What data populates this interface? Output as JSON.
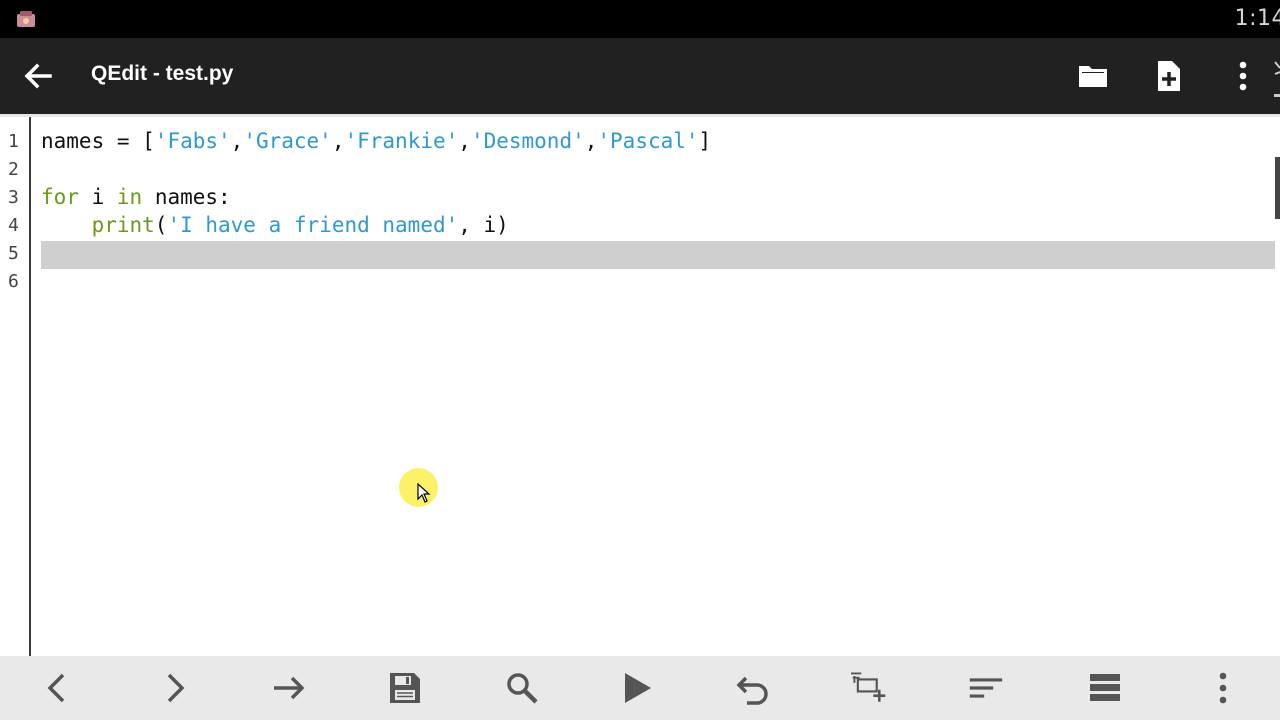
{
  "status": {
    "time": "1:14"
  },
  "header": {
    "title": "QEdit - test.py"
  },
  "editor": {
    "line_numbers": [
      "1",
      "2",
      "3",
      "4",
      "5",
      "6"
    ],
    "lines": {
      "l1": {
        "a": "names = [",
        "s1": "'Fabs'",
        "c1": ",",
        "s2": "'Grace'",
        "c2": ",",
        "s3": "'Frankie'",
        "c3": ",",
        "s4": "'Desmond'",
        "c4": ",",
        "s5": "'Pascal'",
        "end": "]"
      },
      "l3": {
        "kw1": "for",
        "a": " i ",
        "kw2": "in",
        "b": " names:"
      },
      "l4": {
        "indent": "    ",
        "fn": "print",
        "p": "(",
        "s": "'I have a friend named'",
        "rest": ", i)"
      }
    },
    "current_line": 5
  },
  "toolbar_icons": [
    "back-arrow-icon",
    "folder-icon",
    "new-file-icon",
    "more-vert-icon"
  ],
  "bottom_icons": [
    "chevron-left-icon",
    "chevron-right-icon",
    "arrow-right-icon",
    "save-icon",
    "search-icon",
    "play-icon",
    "undo-icon",
    "add-tab-icon",
    "sort-icon",
    "list-icon",
    "more-vert-icon"
  ]
}
